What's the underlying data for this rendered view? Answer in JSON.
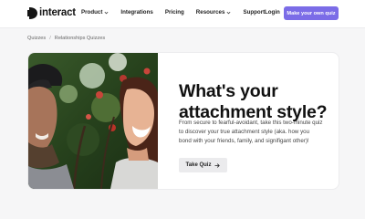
{
  "nav": {
    "logo_text": "interact",
    "items": [
      {
        "label": "Product",
        "dropdown": true
      },
      {
        "label": "Integrations",
        "dropdown": false
      },
      {
        "label": "Pricing",
        "dropdown": false
      },
      {
        "label": "Resources",
        "dropdown": true
      },
      {
        "label": "Support",
        "dropdown": false
      }
    ],
    "login": "Login",
    "cta": "Make your own quiz"
  },
  "breadcrumb": [
    "Quizzes",
    "Relationships Quizzes"
  ],
  "hero": {
    "headline_line1": "What's your",
    "headline_line2": "attachment style?",
    "description": "From secure to fearful-avoidant, take this two-minute quiz to discover your true attachment style (aka. how you bond with your friends, family, and signifigant other)!",
    "button_label": "Take Quiz"
  },
  "colors": {
    "accent": "#7b6ce7",
    "background": "#f6f6f7",
    "card": "#ffffff",
    "button": "#ebebed"
  },
  "icons": [
    "interact-logo-icon",
    "chevron-down-icon",
    "arrow-right-icon"
  ]
}
